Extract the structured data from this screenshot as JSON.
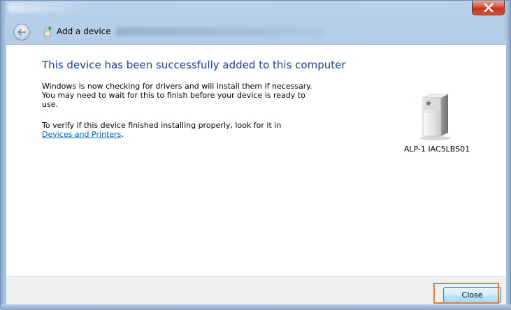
{
  "window": {
    "close_icon": "close-x-icon"
  },
  "nav": {
    "back_icon": "back-arrow-icon",
    "title_icon": "add-device-icon",
    "title": "Add a device"
  },
  "main": {
    "headline": "This device has been successfully added to this computer",
    "paragraph1": "Windows is now checking for drivers and will install them if necessary. You may need to wait for this to finish before your device is ready to use.",
    "paragraph2_prefix": "To verify if this device finished installing properly, look for it in",
    "paragraph2_link": "Devices and Printers",
    "paragraph2_suffix": ".",
    "device_icon": "pc-tower-icon",
    "device_name": "ALP-1 IAC5LBS01"
  },
  "footer": {
    "close_label": "Close"
  },
  "colors": {
    "headline": "#1e3f9a",
    "link": "#0066cc",
    "highlight": "#f07a1c"
  }
}
